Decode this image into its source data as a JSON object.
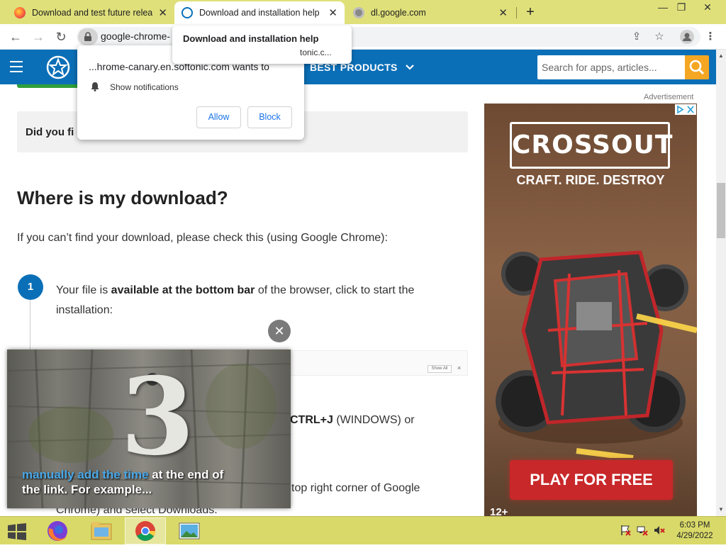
{
  "tabs": [
    {
      "title": "Download and test future release",
      "close": "✕"
    },
    {
      "title": "Download and installation help",
      "close": "✕"
    },
    {
      "title": "dl.google.com",
      "close": "✕"
    }
  ],
  "new_tab": "+",
  "window_controls": {
    "minimize": "—",
    "restore": "❐",
    "close": "✕"
  },
  "toolbar": {
    "back": "←",
    "forward": "→",
    "reload": "↻",
    "url": "google-chrome-"
  },
  "tab_tooltip": {
    "title": "Download and installation help",
    "domain": "tonic.c..."
  },
  "site": {
    "nav_label": "BEST PRODUCTS",
    "search_placeholder": "Search for apps, articles..."
  },
  "notification_prompt": {
    "message": "...hrome-canary.en.softonic.com wants to",
    "permission": "Show notifications",
    "allow": "Allow",
    "block": "Block",
    "close": "✕"
  },
  "article": {
    "did_you": "Did you fi",
    "heading": "Where is my download?",
    "intro": "If you can’t find your download, please check this (using Google Chrome):",
    "step1_number": "1",
    "step1_pre": "Your file is ",
    "step1_bold": "available at the bottom bar",
    "step1_post": " of the browser, click to start the installation:",
    "show_all": "Show All",
    "bar_close": "×",
    "step2_bold": "CTRL+J",
    "step2_post": " (WINDOWS) or",
    "step3_line1": "top right corner of Google",
    "step3_line2": "Chrome) and select Downloads."
  },
  "ad": {
    "label": "Advertisement",
    "logo": "CROSSOUT",
    "tagline": "CRAFT. RIDE. DESTROY",
    "cta": "PLAY FOR FREE",
    "age": "12+"
  },
  "video": {
    "close": "✕",
    "caption_highlight": "manually add the time",
    "caption_rest": " at the end of",
    "caption_line2": "the link. For example...",
    "overlay_number": "3"
  },
  "taskbar": {
    "time": "6:03 PM",
    "date": "4/29/2022"
  },
  "colors": {
    "tabstrip": "#dfe07a",
    "site_header": "#0b6fb7",
    "search_button": "#f5a623",
    "step_circle": "#0b6fb7",
    "ad_cta": "#c8282a",
    "taskbar": "#d9d96a",
    "caption_highlight": "#4aa8e8"
  }
}
